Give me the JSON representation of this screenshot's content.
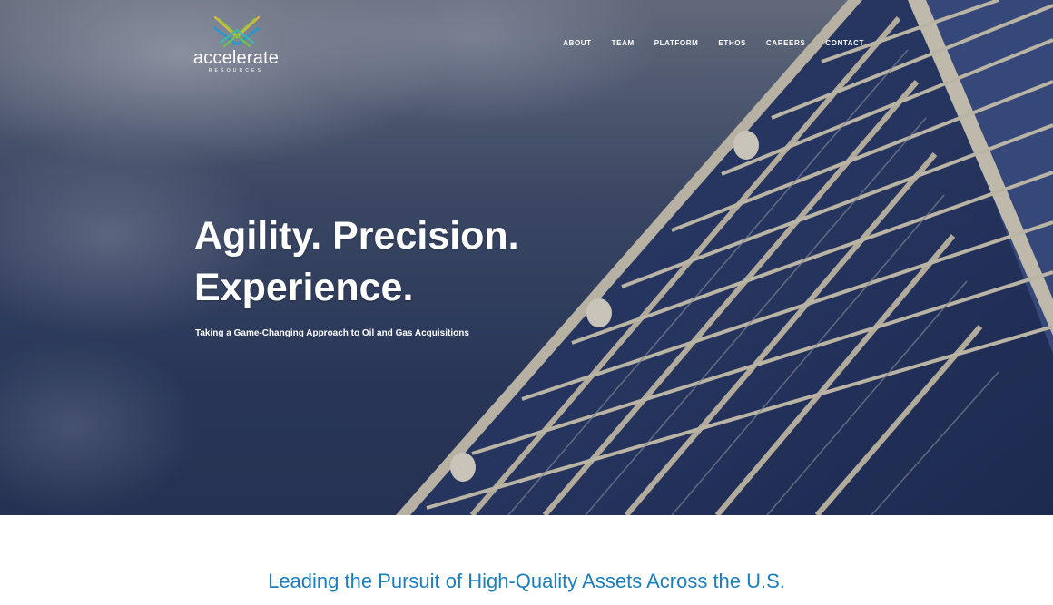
{
  "logo": {
    "wordmark": "accelerate",
    "sub": "RESOURCES",
    "icon": "crossed-chevrons-logo"
  },
  "nav": {
    "items": [
      "ABOUT",
      "TEAM",
      "PLATFORM",
      "ETHOS",
      "CAREERS",
      "CONTACT"
    ]
  },
  "hero": {
    "line1": "Agility. Precision.",
    "line2": "Experience.",
    "tagline": "Taking a Game-Changing Approach to Oil and Gas Acquisitions"
  },
  "section": {
    "heading": "Leading the Pursuit of High-Quality Assets Across the U.S."
  },
  "colors": {
    "accent": "#1a7fc1",
    "sky": "#2c3a5e",
    "text_on_hero": "#ffffff"
  }
}
